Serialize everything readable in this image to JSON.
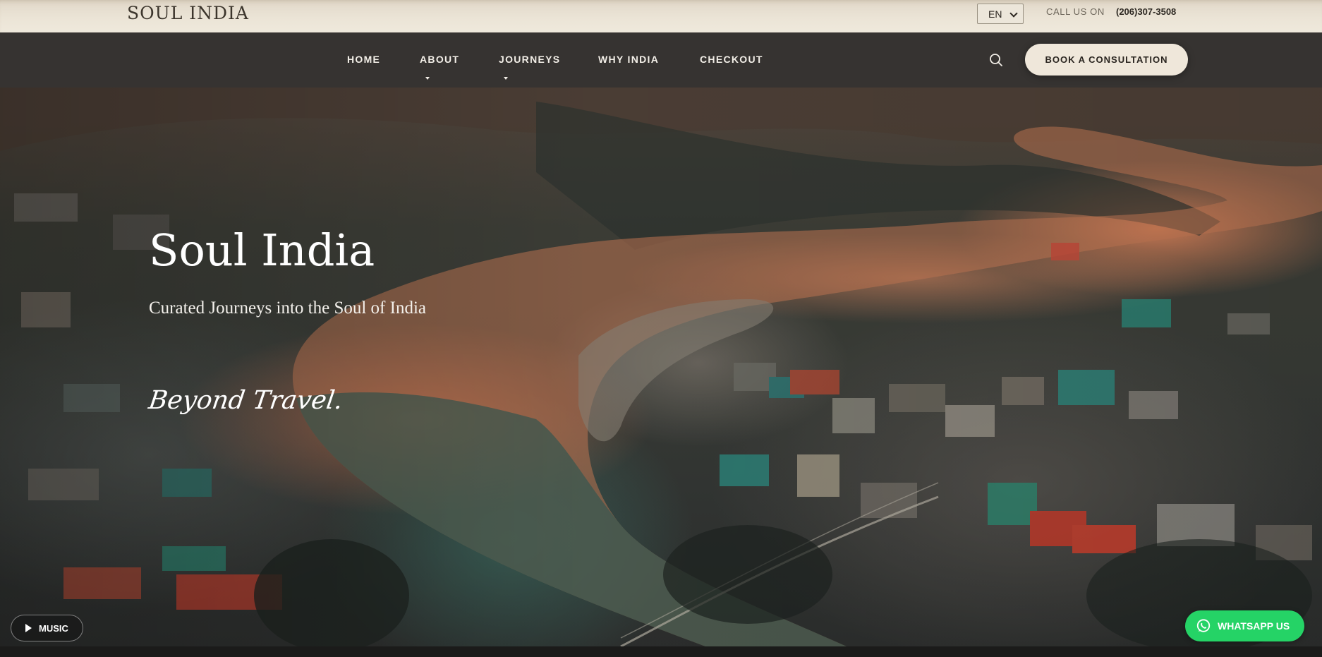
{
  "topbar": {
    "logo": "SOUL INDIA",
    "language": "EN",
    "call_label": "CALL US ON",
    "phone": "(206)307-3508"
  },
  "nav": {
    "items": [
      {
        "label": "HOME",
        "has_dropdown": false
      },
      {
        "label": "ABOUT",
        "has_dropdown": true
      },
      {
        "label": "JOURNEYS",
        "has_dropdown": true
      },
      {
        "label": "WHY INDIA",
        "has_dropdown": false
      },
      {
        "label": "CHECKOUT",
        "has_dropdown": false
      }
    ],
    "search_icon": "search-icon",
    "cta_label": "BOOK A CONSULTATION"
  },
  "hero": {
    "title": "Soul India",
    "subtitle": "Curated Journeys into the Soul of India",
    "tagline": "Beyond Travel."
  },
  "music": {
    "label": "MUSIC",
    "icon": "play-icon"
  },
  "whatsapp": {
    "label": "WHATSAPP US",
    "icon": "whatsapp-icon",
    "color": "#25d366"
  },
  "colors": {
    "topbar_bg": "#ebe4d6",
    "nav_bg": "#363331",
    "cta_bg": "#efe7da",
    "text_light": "#f3efe8"
  }
}
